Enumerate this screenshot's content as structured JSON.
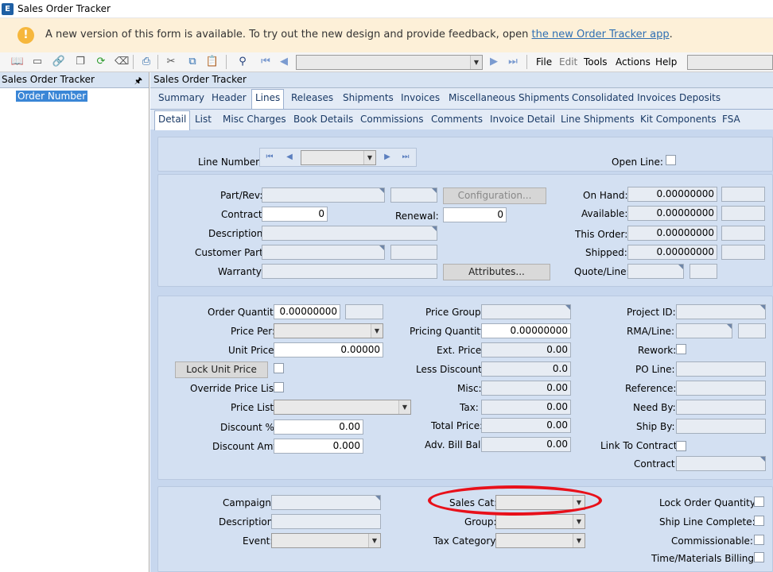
{
  "window": {
    "title": "Sales Order Tracker",
    "icon": "app-icon"
  },
  "banner": {
    "message": "A new version of this form is available. To try out the new design and provide feedback, open ",
    "link": "the new Order Tracker app",
    "suffix": "."
  },
  "toolbar": {
    "menus": [
      "File",
      "Edit",
      "Tools",
      "Actions",
      "Help"
    ]
  },
  "left_panel": {
    "title": "Sales Order Tracker",
    "tree_item": "Order Number"
  },
  "main": {
    "title": "Sales Order Tracker",
    "tabs": [
      "Summary",
      "Header",
      "Lines",
      "Releases",
      "Shipments",
      "Invoices",
      "Miscellaneous Shipments",
      "Consolidated Invoices",
      "Deposits"
    ],
    "subtabs": [
      "Detail",
      "List",
      "Misc Charges",
      "Book Details",
      "Commissions",
      "Comments",
      "Invoice Detail",
      "Line Shipments",
      "Kit Components",
      "FSA"
    ]
  },
  "line": {
    "line_number_label": "Line Number:",
    "open_line_label": "Open Line:"
  },
  "part": {
    "part_rev": "Part/Rev:",
    "contract": "Contract:",
    "contract_val": "0",
    "renewal": "Renewal:",
    "renewal_val": "0",
    "description": "Description:",
    "customer_part": "Customer Part:",
    "warranty": "Warranty:",
    "configuration": "Configuration...",
    "attributes": "Attributes...",
    "on_hand": "On Hand:",
    "on_hand_val": "0.00000000",
    "available": "Available:",
    "available_val": "0.00000000",
    "this_order": "This Order:",
    "this_order_val": "0.00000000",
    "shipped": "Shipped:",
    "shipped_val": "0.00000000",
    "quote_line": "Quote/Line:"
  },
  "pricing": {
    "order_qty": "Order Quantity:",
    "order_qty_val": "0.00000000",
    "price_per": "Price Per:",
    "unit_price": "Unit Price:",
    "unit_price_val": "0.00000",
    "lock_unit_price": "Lock Unit Price",
    "override": "Override Price List:",
    "price_list": "Price List:",
    "discount_pct": "Discount %:",
    "discount_pct_val": "0.00",
    "discount_amt": "Discount Amt:",
    "discount_amt_val": "0.000",
    "price_group": "Price Group:",
    "pricing_qty": "Pricing Quantity:",
    "pricing_qty_val": "0.00000000",
    "ext_price": "Ext. Price:",
    "ext_price_val": "0.00",
    "less_discount": "Less Discount:",
    "less_discount_val": "0.0",
    "misc": "Misc:",
    "misc_val": "0.00",
    "tax": "Tax:",
    "tax_val": "0.00",
    "total": "Total Price:",
    "total_val": "0.00",
    "adv_bill": "Adv. Bill Bal:",
    "adv_bill_val": "0.00",
    "project_id": "Project ID:",
    "rma_line": "RMA/Line:",
    "rework": "Rework:",
    "po_line": "PO Line:",
    "reference": "Reference:",
    "need_by": "Need By:",
    "ship_by": "Ship By:",
    "link_contract": "Link To Contract:",
    "contract": "Contract:"
  },
  "sales": {
    "campaign": "Campaign:",
    "description": "Description:",
    "event": "Event:",
    "sales_cat": "Sales Cat:",
    "group": "Group:",
    "tax_category": "Tax Category:",
    "lock_qty": "Lock Order Quantity:",
    "ship_line_complete": "Ship Line Complete:",
    "commissionable": "Commissionable:",
    "tm_billing": "Time/Materials Billing:"
  },
  "colors": {
    "banner_bg": "#fdf0d8",
    "panel_bg": "#c7d7ee",
    "group_bg": "#d3e0f2",
    "selected": "#3a86d6",
    "annotation": "#e8101a"
  }
}
